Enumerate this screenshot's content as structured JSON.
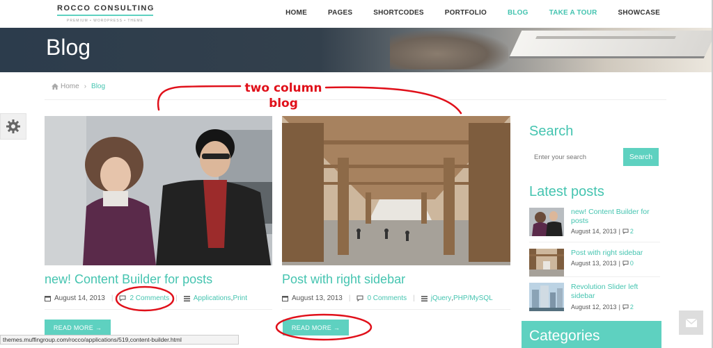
{
  "header": {
    "logo_title": "ROCCO CONSULTING",
    "logo_subtitle": "PREMIUM • WORDPRESS • THEME",
    "nav": [
      {
        "label": "HOME"
      },
      {
        "label": "PAGES"
      },
      {
        "label": "SHORTCODES"
      },
      {
        "label": "PORTFOLIO"
      },
      {
        "label": "BLOG"
      },
      {
        "label": "TAKE A TOUR"
      },
      {
        "label": "SHOWCASE"
      }
    ],
    "active_color": "#45c4b0"
  },
  "banner": {
    "title": "Blog"
  },
  "breadcrumb": {
    "home": "Home",
    "current": "Blog"
  },
  "annotation": {
    "line1": "two column",
    "line2": "blog",
    "color": "#e0101a"
  },
  "posts": [
    {
      "title": "new! Content Builder for posts",
      "date": "August 14, 2013",
      "comments": "2 Comments",
      "cat1": "Applications",
      "cat2": "Print",
      "read_more": "READ MORE →"
    },
    {
      "title": "Post with right sidebar",
      "date": "August 13, 2013",
      "comments": "0 Comments",
      "cat1": "jQuery",
      "cat2": "PHP/MySQL",
      "read_more": "READ MORE →"
    }
  ],
  "sidebar": {
    "search_heading": "Search",
    "search_placeholder": "Enter your search",
    "search_button": "Search",
    "latest_heading": "Latest posts",
    "latest": [
      {
        "title": "new! Content Builder for posts",
        "date": "August 14, 2013",
        "comments": "2"
      },
      {
        "title": "Post with right sidebar",
        "date": "August 13, 2013",
        "comments": "0"
      },
      {
        "title": "Revolution Slider left sidebar",
        "date": "August 12, 2013",
        "comments": "2"
      }
    ],
    "categories_heading": "Categories"
  },
  "statusbar": {
    "url": "themes.muffingroup.com/rocco/applications/519,content-builder.html"
  },
  "colors": {
    "accent": "#5ed1c0",
    "link": "#45c4b0",
    "banner": "#2c3c4c"
  }
}
